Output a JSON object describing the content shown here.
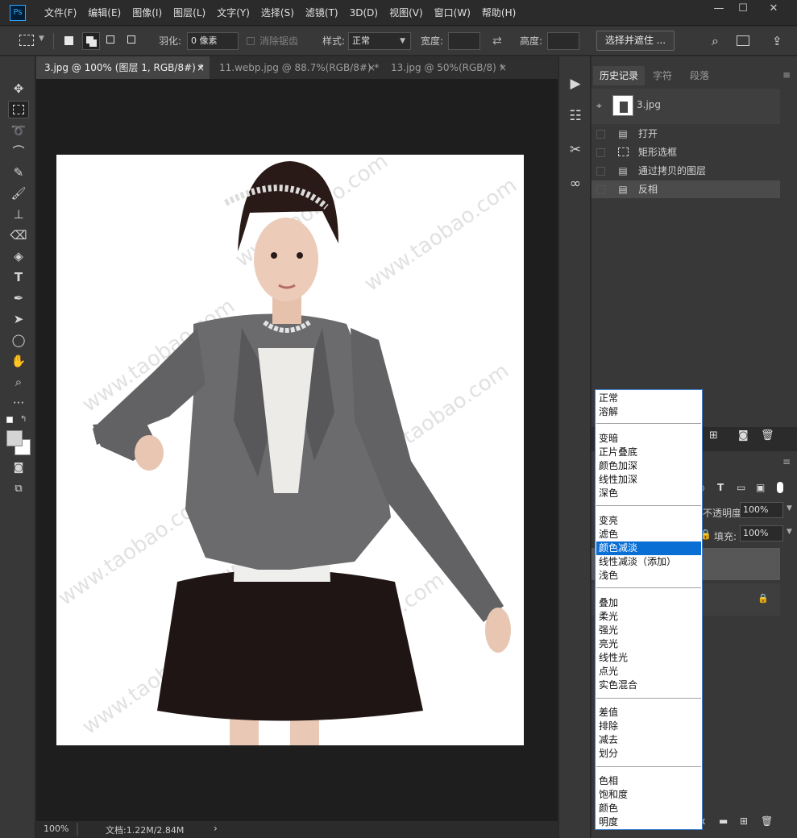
{
  "menubar": {
    "logo": "Ps",
    "items": [
      "文件(F)",
      "编辑(E)",
      "图像(I)",
      "图层(L)",
      "文字(Y)",
      "选择(S)",
      "滤镜(T)",
      "3D(D)",
      "视图(V)",
      "窗口(W)",
      "帮助(H)"
    ],
    "window_buttons": [
      "—",
      "☐",
      "✕"
    ]
  },
  "options": {
    "feather_label": "羽化:",
    "feather_value": "0 像素",
    "antialias_label": "消除锯齿",
    "style_label": "样式:",
    "style_value": "正常",
    "width_label": "宽度:",
    "height_label": "高度:",
    "select_mask_button": "选择并遮住 ..."
  },
  "tabs": [
    {
      "label": "3.jpg @ 100% (图层 1, RGB/8#) *",
      "close": "×"
    },
    {
      "label": "11.webp.jpg @ 88.7%(RGB/8#) *",
      "close": "×"
    },
    {
      "label": "13.jpg @ 50%(RGB/8) *",
      "close": "×"
    }
  ],
  "status": {
    "zoom": "100%",
    "doc": "文档:1.22M/2.84M",
    "arrow": "›"
  },
  "canvas": {
    "watermark": "www.taobao.com"
  },
  "history": {
    "tabs": [
      "历史记录",
      "字符",
      "段落"
    ],
    "snapshot": "3.jpg",
    "steps": [
      {
        "label": "打开",
        "icon": "document-icon"
      },
      {
        "label": "矩形选框",
        "icon": "marquee-icon"
      },
      {
        "label": "通过拷贝的图层",
        "icon": "document-icon"
      },
      {
        "label": "反相",
        "icon": "document-icon"
      }
    ]
  },
  "layers": {
    "opacity_label": "不透明度:",
    "opacity_value": "100%",
    "fill_label": "填充:",
    "fill_value": "100%",
    "filter_t": "T"
  },
  "blend_modes": {
    "selected": "颜色减淡",
    "groups": [
      [
        "正常",
        "溶解"
      ],
      [
        "变暗",
        "正片叠底",
        "颜色加深",
        "线性加深",
        "深色"
      ],
      [
        "变亮",
        "滤色",
        "颜色减淡",
        "线性减淡（添加）",
        "浅色"
      ],
      [
        "叠加",
        "柔光",
        "强光",
        "亮光",
        "线性光",
        "点光",
        "实色混合"
      ],
      [
        "差值",
        "排除",
        "减去",
        "划分"
      ],
      [
        "色相",
        "饱和度",
        "颜色",
        "明度"
      ]
    ]
  },
  "colors": {
    "accent": "#0a6fd4",
    "panel": "#383838",
    "canvas_bg": "#1e1e1e",
    "jacket": "#6b6b6e",
    "skirt": "#201515",
    "hair": "#2a1a17"
  }
}
